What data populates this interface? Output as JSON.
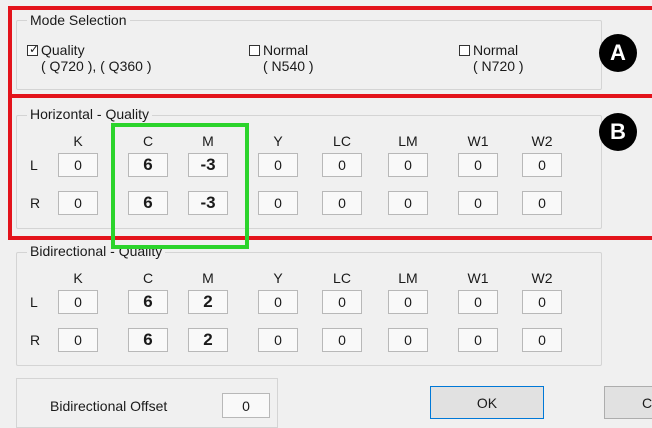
{
  "mode_selection": {
    "title": "Mode Selection",
    "options": [
      {
        "label": "Quality",
        "sub": "( Q720 ), ( Q360 )",
        "checked": true
      },
      {
        "label": "Normal",
        "sub": "( N540 )",
        "checked": false
      },
      {
        "label": "Normal",
        "sub": "( N720 )",
        "checked": false
      }
    ]
  },
  "columns": [
    "K",
    "C",
    "M",
    "Y",
    "LC",
    "LM",
    "W1",
    "W2"
  ],
  "rows": [
    "L",
    "R"
  ],
  "horizontal": {
    "title": "Horizontal  -  Quality",
    "values": [
      [
        "0",
        "6",
        "-3",
        "0",
        "0",
        "0",
        "0",
        "0"
      ],
      [
        "0",
        "6",
        "-3",
        "0",
        "0",
        "0",
        "0",
        "0"
      ]
    ]
  },
  "bidirectional": {
    "title": "Bidirectional  -  Quality",
    "values": [
      [
        "0",
        "6",
        "2",
        "0",
        "0",
        "0",
        "0",
        "0"
      ],
      [
        "0",
        "6",
        "2",
        "0",
        "0",
        "0",
        "0",
        "0"
      ]
    ]
  },
  "offset": {
    "label": "Bidirectional Offset",
    "value": "0"
  },
  "buttons": {
    "ok": "OK",
    "cancel": "Ca"
  },
  "annotations": {
    "a": "A",
    "b": "B"
  },
  "colors": {
    "red": "#e3131b",
    "green": "#2bd42b"
  }
}
